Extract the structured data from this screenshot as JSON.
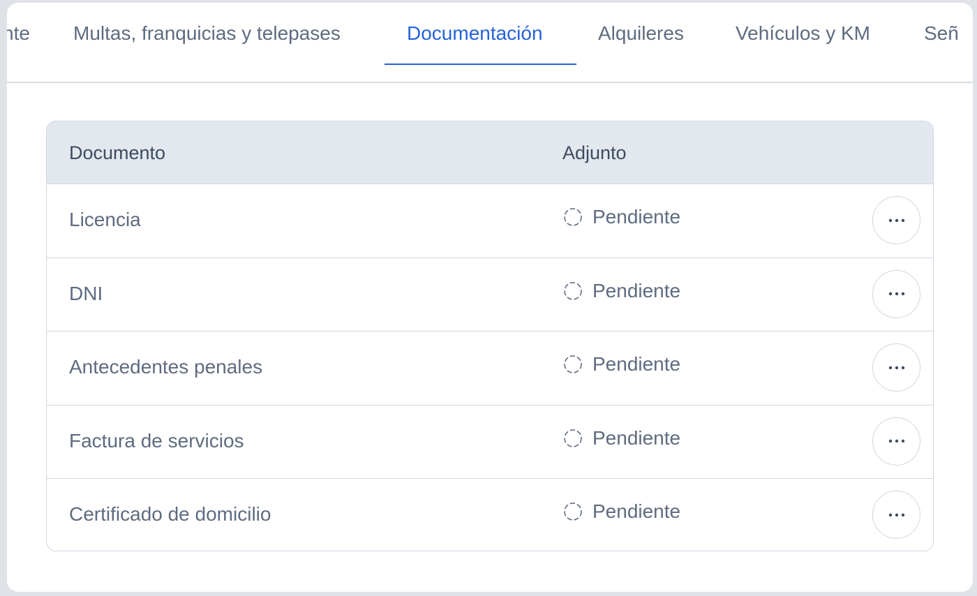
{
  "tabs": [
    {
      "label": "nte",
      "active": false
    },
    {
      "label": "Multas, franquicias y telepases",
      "active": false
    },
    {
      "label": "Documentación",
      "active": true
    },
    {
      "label": "Alquileres",
      "active": false
    },
    {
      "label": "Vehículos y KM",
      "active": false
    },
    {
      "label": "Señ",
      "active": false
    }
  ],
  "table": {
    "headers": {
      "document": "Documento",
      "attachment": "Adjunto"
    },
    "rows": [
      {
        "document": "Licencia",
        "status": "Pendiente"
      },
      {
        "document": "DNI",
        "status": "Pendiente"
      },
      {
        "document": "Antecedentes penales",
        "status": "Pendiente"
      },
      {
        "document": "Factura de servicios",
        "status": "Pendiente"
      },
      {
        "document": "Certificado de domicilio",
        "status": "Pendiente"
      }
    ]
  },
  "icons": {
    "status": "dashed-circle-icon",
    "row_menu": "more-horizontal-icon"
  },
  "colors": {
    "accent": "#2563d9",
    "text": "#5e6b7f",
    "header_bg": "#e3e8ef",
    "border": "#cfd7e1"
  }
}
